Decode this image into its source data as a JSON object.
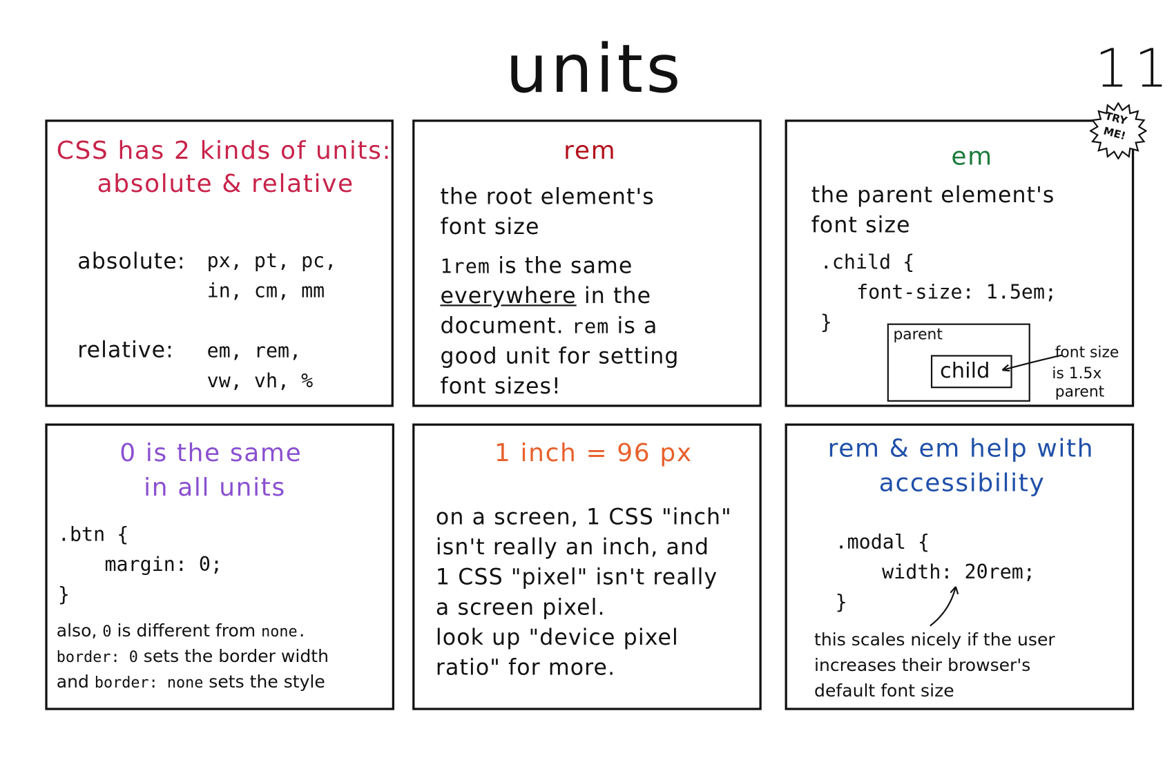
{
  "title": "units",
  "page_number": "11",
  "badge": {
    "line1": "TRY",
    "line2": "ME!"
  },
  "colors": {
    "absolute_relative": "#c8234a",
    "rem": "#b3101b",
    "em": "#1a7a3a",
    "zero": "#8a4fd0",
    "inch": "#e8602c",
    "accessibility": "#1f4fa8"
  },
  "panels": {
    "kinds": {
      "title1": "CSS has 2 kinds of units:",
      "title2": "absolute & relative",
      "absolute_label": "absolute:",
      "absolute_units1": "px, pt, pc,",
      "absolute_units2": "in, cm, mm",
      "relative_label": "relative:",
      "relative_units1": "em, rem,",
      "relative_units2": "vw, vh, %"
    },
    "rem": {
      "title": "rem",
      "line1": "the root element's",
      "line2": "font size",
      "l3_code": "1rem",
      "l3_text": " is the same",
      "l4_under": "everywhere",
      "l4_text": " in the",
      "l5_text": "document. ",
      "l5_code": "rem",
      "l5_text2": " is a",
      "line6": "good unit for setting",
      "line7": "font sizes!"
    },
    "em": {
      "title": "em",
      "line1": "the parent element's",
      "line2": "font size",
      "code1": ".child {",
      "code2": "font-size: 1.5em;",
      "code3": "}",
      "parent_label": "parent",
      "child_label": "child",
      "note1": "font size",
      "note2": "is 1.5x",
      "note3": "parent"
    },
    "zero": {
      "title1": "0 is the same",
      "title2": "in all units",
      "code1": ".btn {",
      "code2": "margin: 0;",
      "code3": "}",
      "a1": "also, ",
      "a2": "0",
      "a3": " is different from ",
      "a4": "none.",
      "b1": "border: 0",
      "b2": " sets the border width",
      "c1": "and ",
      "c2": "border: none",
      "c3": " sets the style"
    },
    "inch": {
      "title": "1 inch = 96 px",
      "line1": "on a screen, 1 CSS \"inch\"",
      "line2": "isn't really an inch, and",
      "line3": "1 CSS \"pixel\" isn't really",
      "line4": "a screen pixel.",
      "line5": "look up \"device pixel",
      "line6": "ratio\" for more."
    },
    "access": {
      "title1": "rem & em help with",
      "title2": "accessibility",
      "code1": ".modal {",
      "code2": "width: 20rem;",
      "code3": "}",
      "line1": "this scales nicely if the user",
      "line2": "increases their browser's",
      "line3": "default font size"
    }
  }
}
